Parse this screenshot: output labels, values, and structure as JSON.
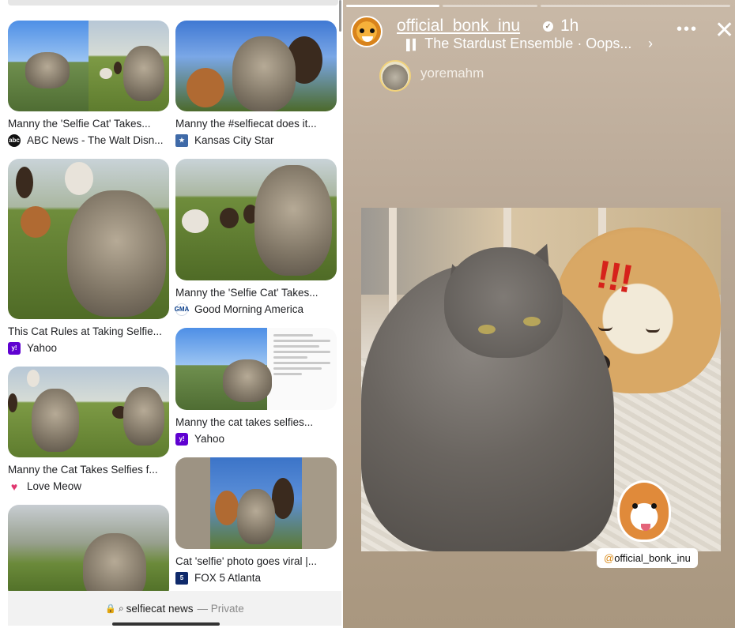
{
  "left_panel": {
    "results": [
      {
        "title": "Manny the 'Selfie Cat' Takes...",
        "source": "ABC News - The Walt Disn...",
        "favicon": "abc-logo-icon"
      },
      {
        "title": "Manny the #selfiecat does it...",
        "source": "Kansas City Star",
        "favicon": "star-logo-icon"
      },
      {
        "title": "This Cat Rules at Taking Selfie...",
        "source": "Yahoo",
        "favicon": "yahoo-logo-icon"
      },
      {
        "title": "Manny the 'Selfie Cat' Takes...",
        "source": "Good Morning America",
        "favicon": "gma-logo-icon"
      },
      {
        "title": "Manny the Cat Takes Selfies f...",
        "source": "Love Meow",
        "favicon": "heart-logo-icon"
      },
      {
        "title": "Manny the cat takes selfies...",
        "source": "Yahoo",
        "favicon": "yahoo-logo-icon"
      },
      {
        "title": "Cat 'selfie' photo goes viral |...",
        "source": "FOX 5 Atlanta",
        "favicon": "fox5-logo-icon"
      }
    ],
    "search_bar": {
      "query": "selfiecat news",
      "separator": "—",
      "mode": "Private"
    }
  },
  "story": {
    "username": "official_bonk_inu",
    "time": "1h",
    "music": "The Stardust Ensemble · Oops...",
    "reposted_from": "yoremahm",
    "mention": "official_bonk_inu",
    "mention_prefix": "@",
    "progress": [
      1.0,
      0.0,
      0.0
    ]
  },
  "colors": {
    "yahoo": "#5f01d1",
    "abc": "#111111",
    "kcs": "#3f6aa8",
    "fox": "#0f2a6b",
    "exclamation": "#d6221b"
  }
}
